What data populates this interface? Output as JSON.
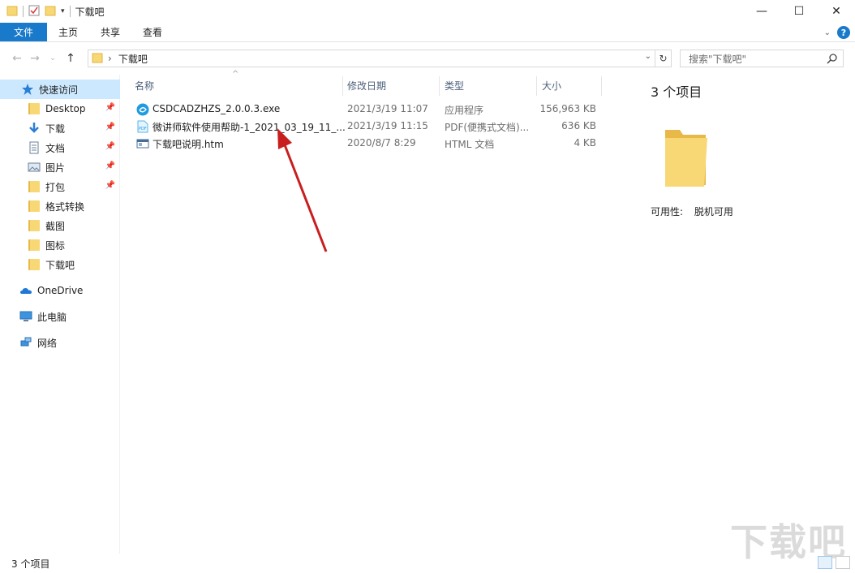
{
  "window": {
    "title": "下载吧",
    "minimize": "—",
    "maximize": "☐",
    "close": "✕"
  },
  "ribbon": {
    "tabs": [
      "文件",
      "主页",
      "共享",
      "查看"
    ],
    "help": "?"
  },
  "address": {
    "path": "下载吧",
    "search_placeholder": "搜索\"下载吧\""
  },
  "sidebar": {
    "items": [
      {
        "label": "快速访问",
        "icon": "star-icon",
        "pinned": false
      },
      {
        "label": "Desktop",
        "icon": "folder-icon",
        "pinned": true
      },
      {
        "label": "下载",
        "icon": "download-arrow-icon",
        "pinned": true
      },
      {
        "label": "文档",
        "icon": "document-icon",
        "pinned": true
      },
      {
        "label": "图片",
        "icon": "pictures-icon",
        "pinned": true
      },
      {
        "label": "打包",
        "icon": "folder-icon",
        "pinned": true
      },
      {
        "label": "格式转换",
        "icon": "folder-icon",
        "pinned": false
      },
      {
        "label": "截图",
        "icon": "folder-icon",
        "pinned": false
      },
      {
        "label": "图标",
        "icon": "folder-icon",
        "pinned": false
      },
      {
        "label": "下载吧",
        "icon": "folder-icon",
        "pinned": false
      },
      {
        "label": "OneDrive",
        "icon": "cloud-icon",
        "pinned": false
      },
      {
        "label": "此电脑",
        "icon": "computer-icon",
        "pinned": false
      },
      {
        "label": "网络",
        "icon": "network-icon",
        "pinned": false
      }
    ]
  },
  "columns": {
    "name": "名称",
    "date": "修改日期",
    "type": "类型",
    "size": "大小"
  },
  "files": [
    {
      "name": "CSDCADZHZS_2.0.0.3.exe",
      "date": "2021/3/19 11:07",
      "type": "应用程序",
      "size": "156,963 KB",
      "icon": "exe-icon"
    },
    {
      "name": "微讲师软件使用帮助-1_2021_03_19_11_...",
      "date": "2021/3/19 11:15",
      "type": "PDF(便携式文档)...",
      "size": "636 KB",
      "icon": "pdf-icon"
    },
    {
      "name": "下载吧说明.htm",
      "date": "2020/8/7 8:29",
      "type": "HTML 文档",
      "size": "4 KB",
      "icon": "htm-icon"
    }
  ],
  "preview": {
    "count": "3 个项目",
    "availability_label": "可用性:",
    "availability_value": "脱机可用"
  },
  "status": {
    "count": "3 个项目"
  },
  "colors": {
    "accent": "#1979ca",
    "selected": "#cce8ff",
    "folder": "#f8d775",
    "arrow": "#d42020"
  }
}
